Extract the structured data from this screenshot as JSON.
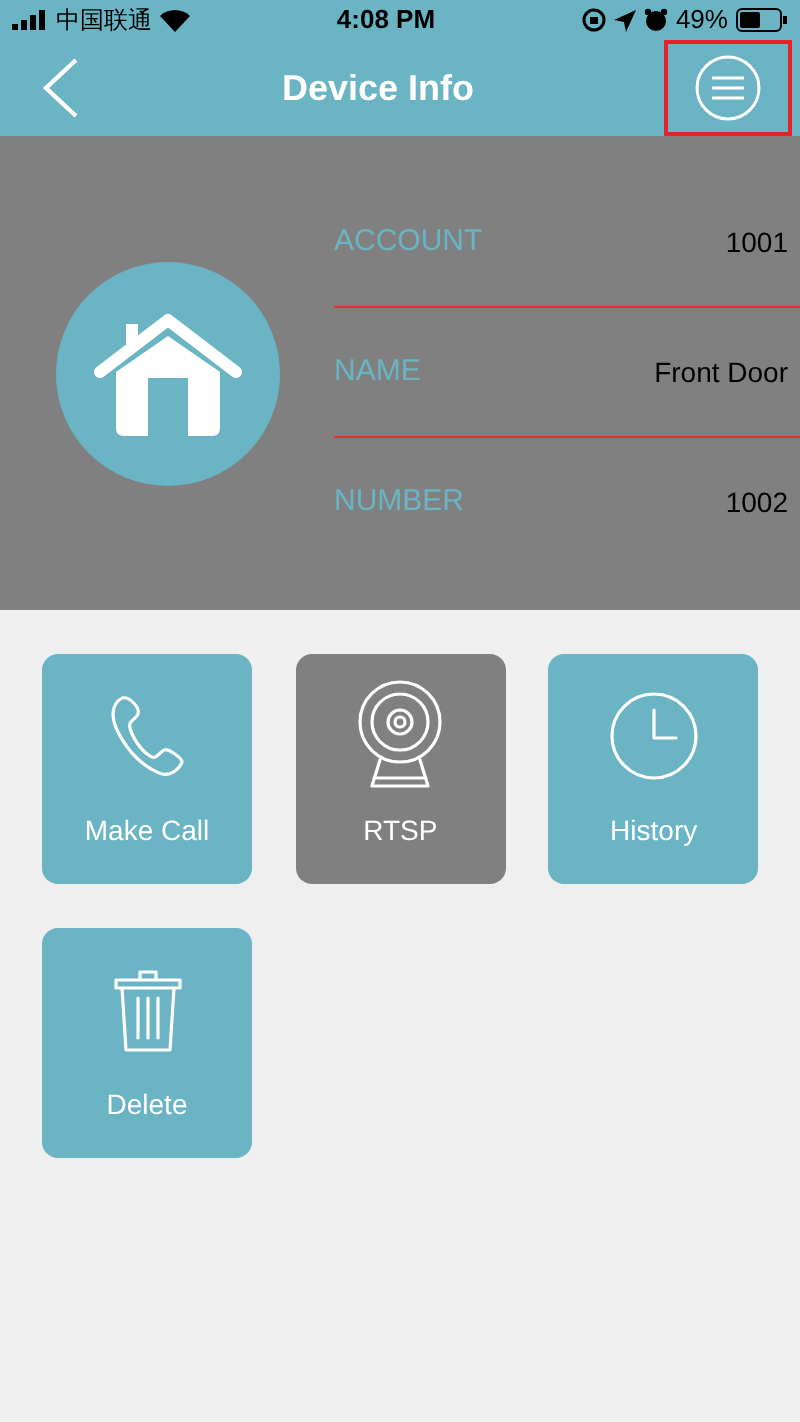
{
  "status_bar": {
    "carrier": "中国联通",
    "time": "4:08 PM",
    "battery": "49%"
  },
  "header": {
    "title": "Device Info",
    "menu_highlighted": true
  },
  "device": {
    "fields": [
      {
        "label": "ACCOUNT",
        "value": "1001"
      },
      {
        "label": "NAME",
        "value": "Front Door"
      },
      {
        "label": "NUMBER",
        "value": "1002"
      }
    ]
  },
  "actions": [
    {
      "label": "Make Call",
      "kind": "call",
      "selected": false
    },
    {
      "label": "RTSP",
      "kind": "camera",
      "selected": true
    },
    {
      "label": "History",
      "kind": "history",
      "selected": false
    },
    {
      "label": "Delete",
      "kind": "delete",
      "selected": false
    }
  ]
}
